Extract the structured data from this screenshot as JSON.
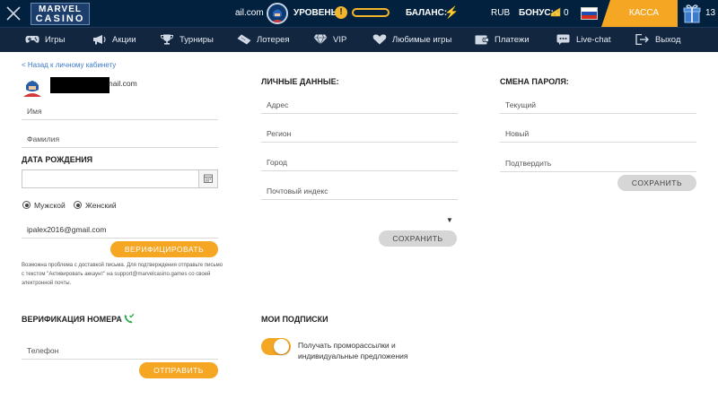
{
  "header": {
    "logo_line1": "MARVEL",
    "logo_line2": "CASINO",
    "email_short": "ail.com",
    "level_label": "УРОВЕНЬ:",
    "level_icon": "!",
    "balance_label": "БАЛАНС:",
    "bolt_icon": "⚡",
    "currency": "RUB",
    "bonus_label": "БОНУС:",
    "bonus_value": "0",
    "cash_button": "КАССА",
    "gift_count": "13",
    "accent_color": "#f5a623",
    "header_bg": "#02213f"
  },
  "nav": {
    "items": [
      {
        "label": "Игры",
        "icon": "gamepad-icon"
      },
      {
        "label": "Акции",
        "icon": "megaphone-icon"
      },
      {
        "label": "Турниры",
        "icon": "trophy-icon"
      },
      {
        "label": "Лотерея",
        "icon": "ticket-icon"
      },
      {
        "label": "VIP",
        "icon": "diamond-icon"
      },
      {
        "label": "Любимые игры",
        "icon": "heart-icon"
      },
      {
        "label": "Платежи",
        "icon": "wallet-icon"
      },
      {
        "label": "Live-chat",
        "icon": "chat-icon"
      },
      {
        "label": "Выход",
        "icon": "logout-icon"
      }
    ]
  },
  "profile": {
    "back_link": "< Назад к личному кабинету",
    "email_tail": "nail.com",
    "name_placeholder": "Имя",
    "surname_placeholder": "Фамилия",
    "birth_title": "ДАТА РОЖДЕНИЯ",
    "gender_male": "Мужской",
    "gender_female": "Женский",
    "email_value": "ipalex2016@gmail.com",
    "verify_button": "ВЕРИФИЦИРОВАТЬ",
    "note": "Возможна проблема с доставкой письма. Для подтверждения отправьте письмо с текстом \"Активировать аккаунт\" на support@marvelcasino.games со своей электронной почты."
  },
  "phone": {
    "title": "ВЕРИФИКАЦИЯ НОМЕРА",
    "phone_placeholder": "Телефон",
    "send_button": "ОТПРАВИТЬ"
  },
  "personal": {
    "title": "ЛИЧНЫЕ ДАННЫЕ:",
    "address": "Адрес",
    "region": "Регион",
    "city": "Город",
    "postal": "Почтовый индекс",
    "save_button": "СОХРАНИТЬ"
  },
  "subscriptions": {
    "title": "МОИ ПОДПИСКИ",
    "promo_label": "Получать проморассылки и индивидуальные предложения",
    "promo_enabled": true
  },
  "password": {
    "title": "СМЕНА ПАРОЛЯ:",
    "current": "Текущий",
    "new": "Новый",
    "confirm": "Подтвердить",
    "save_button": "СОХРАНИТЬ"
  }
}
